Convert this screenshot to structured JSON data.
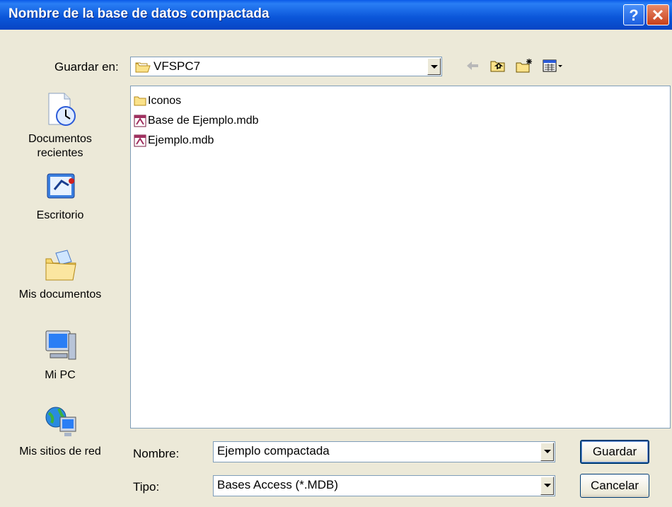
{
  "window": {
    "title": "Nombre de la base de datos compactada",
    "help_label": "?",
    "close_label": "✕"
  },
  "save_in": {
    "label": "Guardar en:",
    "value": "VFSPC7"
  },
  "toolbar": {
    "icons": [
      "back-arrow-icon",
      "up-one-level-icon",
      "new-folder-icon",
      "view-menu-icon"
    ]
  },
  "places": [
    {
      "label_line1": "Documentos",
      "label_line2": "recientes",
      "icon": "recent-documents-icon"
    },
    {
      "label_line1": "Escritorio",
      "label_line2": "",
      "icon": "desktop-icon"
    },
    {
      "label_line1": "Mis documentos",
      "label_line2": "",
      "icon": "my-documents-icon"
    },
    {
      "label_line1": "Mi PC",
      "label_line2": "",
      "icon": "my-computer-icon"
    },
    {
      "label_line1": "Mis sitios de red",
      "label_line2": "",
      "icon": "network-places-icon"
    }
  ],
  "files": [
    {
      "name": "Iconos",
      "type": "folder"
    },
    {
      "name": "Base de Ejemplo.mdb",
      "type": "access-db"
    },
    {
      "name": "Ejemplo.mdb",
      "type": "access-db"
    }
  ],
  "filename": {
    "label": "Nombre:",
    "value": "Ejemplo compactada"
  },
  "filetype": {
    "label": "Tipo:",
    "value": "Bases Access (*.MDB)"
  },
  "buttons": {
    "save": "Guardar",
    "cancel": "Cancelar"
  }
}
